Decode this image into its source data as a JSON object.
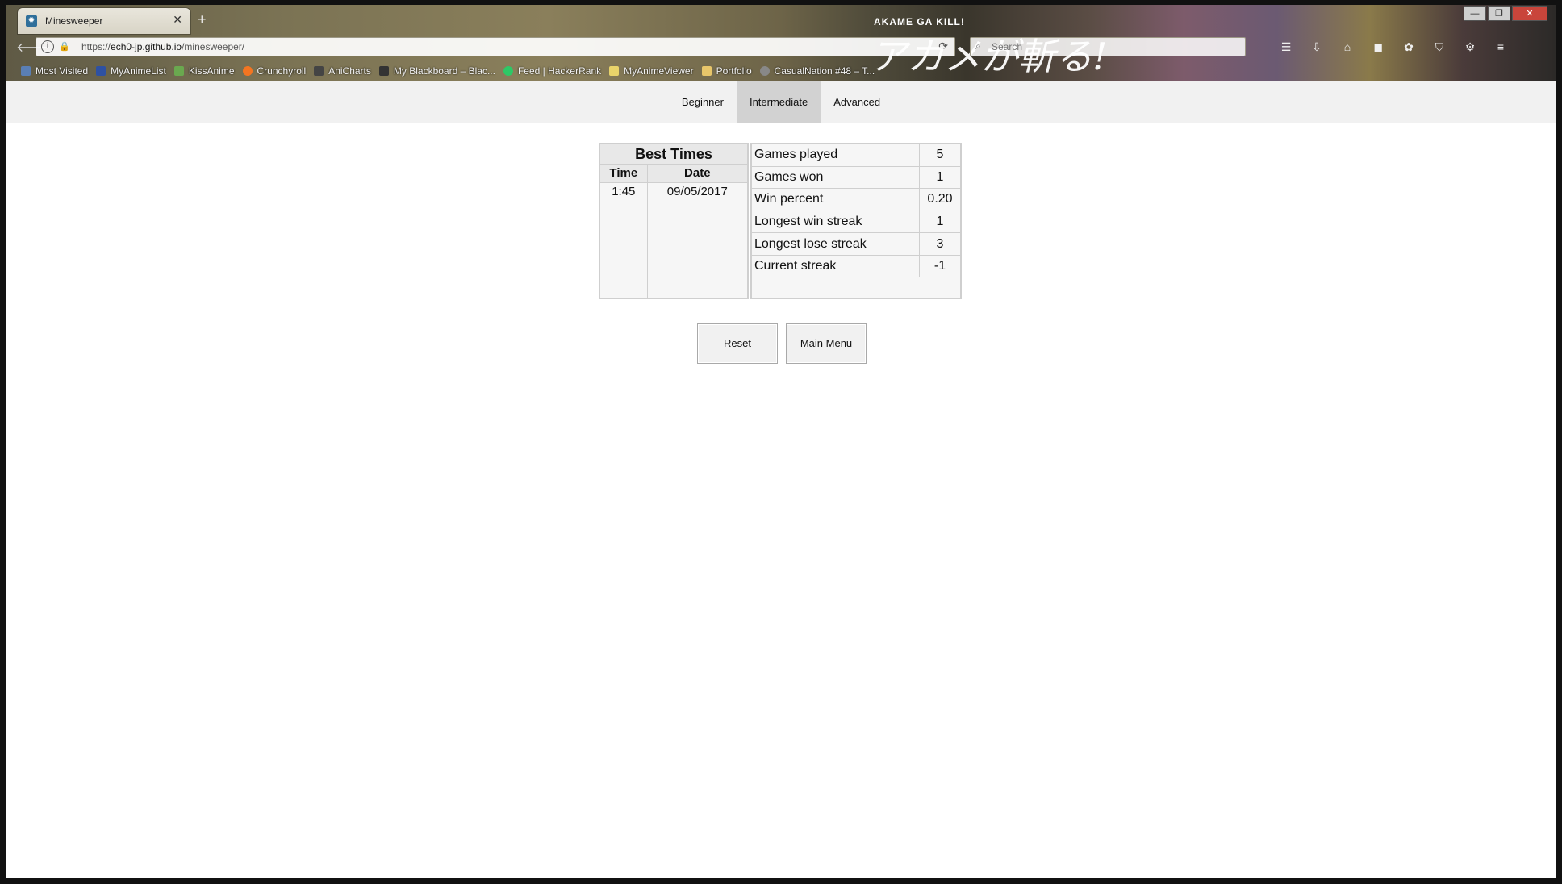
{
  "browser": {
    "tab": {
      "title": "Minesweeper",
      "close": "✕"
    },
    "new_tab": "+",
    "url": {
      "prefix": "https://",
      "host": "ech0-jp.github.io",
      "path": "/minesweeper/"
    },
    "search_placeholder": "Search",
    "window_controls": {
      "minimize": "—",
      "maximize": "❐",
      "close": "✕"
    },
    "theme_logo": {
      "top": "AKAME GA KILL!",
      "jp": "アカメが斬る!"
    },
    "bookmarks": [
      {
        "label": "Most Visited",
        "color": "#5a7fb5"
      },
      {
        "label": "MyAnimeList",
        "color": "#2e51a2"
      },
      {
        "label": "KissAnime",
        "color": "#6aa84f"
      },
      {
        "label": "Crunchyroll",
        "color": "#f47521"
      },
      {
        "label": "AniCharts",
        "color": "#444444"
      },
      {
        "label": "My Blackboard – Blac...",
        "color": "#333333"
      },
      {
        "label": "Feed | HackerRank",
        "color": "#2ec866"
      },
      {
        "label": "MyAnimeViewer",
        "color": "#e8d36a"
      },
      {
        "label": "Portfolio",
        "color": "#e8c66a"
      },
      {
        "label": "CasualNation #48 – T...",
        "color": "#888888"
      }
    ]
  },
  "nav": {
    "tabs": [
      {
        "label": "Beginner",
        "active": false
      },
      {
        "label": "Intermediate",
        "active": true
      },
      {
        "label": "Advanced",
        "active": false
      }
    ]
  },
  "best_times": {
    "title": "Best Times",
    "col_time": "Time",
    "col_date": "Date",
    "rows": [
      {
        "time": "1:45",
        "date": "09/05/2017"
      }
    ]
  },
  "stats": [
    {
      "label": "Games played",
      "value": "5"
    },
    {
      "label": "Games won",
      "value": "1"
    },
    {
      "label": "Win percent",
      "value": "0.20"
    },
    {
      "label": "Longest win streak",
      "value": "1"
    },
    {
      "label": "Longest lose streak",
      "value": "3"
    },
    {
      "label": "Current streak",
      "value": "-1"
    }
  ],
  "buttons": {
    "reset": "Reset",
    "main_menu": "Main Menu"
  }
}
